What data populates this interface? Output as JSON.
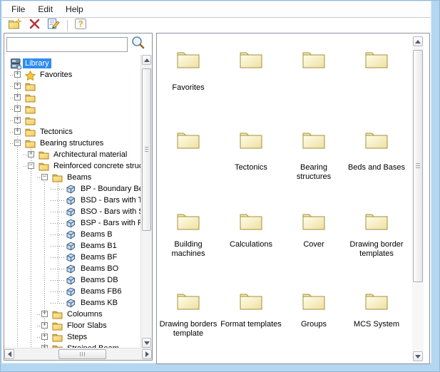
{
  "menu": {
    "items": [
      "File",
      "Edit",
      "Help"
    ]
  },
  "toolbar": {
    "buttons": [
      {
        "icon": "new-folder-icon"
      },
      {
        "icon": "delete-icon"
      },
      {
        "icon": "edit-icon"
      },
      {
        "icon": "help-icon"
      }
    ]
  },
  "search": {
    "value": "",
    "placeholder": "",
    "icon": "search-icon"
  },
  "colors": {
    "selection_blue": "#2e8def",
    "frame_blue": "#b5d6f0",
    "folder_yellow": "#f6e49c",
    "tree_folder_yellow": "#f9d978",
    "delete_red": "#b2353c"
  },
  "tree": {
    "rows": [
      {
        "level": 0,
        "icon": "library",
        "label": "Library",
        "expand": "",
        "selected": true
      },
      {
        "level": 1,
        "icon": "star",
        "label": "Favorites",
        "expand": "+"
      },
      {
        "level": 1,
        "icon": "folder",
        "label": "",
        "expand": "+"
      },
      {
        "level": 1,
        "icon": "folder",
        "label": "",
        "expand": "+"
      },
      {
        "level": 1,
        "icon": "folder",
        "label": "",
        "expand": "+"
      },
      {
        "level": 1,
        "icon": "folder",
        "label": "",
        "expand": "+"
      },
      {
        "level": 1,
        "icon": "folder",
        "label": "Tectonics",
        "expand": "+"
      },
      {
        "level": 1,
        "icon": "folder",
        "label": "Bearing structures",
        "expand": "-"
      },
      {
        "level": 2,
        "icon": "folder",
        "label": "Architectural material",
        "expand": "+"
      },
      {
        "level": 2,
        "icon": "folder",
        "label": "Reinforced concrete struct",
        "expand": "-"
      },
      {
        "level": 3,
        "icon": "folder",
        "label": "Beams",
        "expand": "-"
      },
      {
        "level": 4,
        "icon": "block",
        "label": "BP - Boundary Bea",
        "expand": ""
      },
      {
        "level": 4,
        "icon": "block",
        "label": "BSD - Bars with Tw",
        "expand": ""
      },
      {
        "level": 4,
        "icon": "block",
        "label": "BSO - Bars with Sl",
        "expand": ""
      },
      {
        "level": 4,
        "icon": "block",
        "label": "BSP - Bars with Pa",
        "expand": ""
      },
      {
        "level": 4,
        "icon": "block",
        "label": "Beams B",
        "expand": ""
      },
      {
        "level": 4,
        "icon": "block",
        "label": "Beams B1",
        "expand": ""
      },
      {
        "level": 4,
        "icon": "block",
        "label": "Beams BF",
        "expand": ""
      },
      {
        "level": 4,
        "icon": "block",
        "label": "Beams BO",
        "expand": ""
      },
      {
        "level": 4,
        "icon": "block",
        "label": "Beams DB",
        "expand": ""
      },
      {
        "level": 4,
        "icon": "block",
        "label": "Beams FB6",
        "expand": ""
      },
      {
        "level": 4,
        "icon": "block",
        "label": "Beams KB",
        "expand": ""
      },
      {
        "level": 3,
        "icon": "folder",
        "label": "Coloumns",
        "expand": "+"
      },
      {
        "level": 3,
        "icon": "folder",
        "label": "Floor Slabs",
        "expand": "+"
      },
      {
        "level": 3,
        "icon": "folder",
        "label": "Steps",
        "expand": "+"
      },
      {
        "level": 3,
        "icon": "folder",
        "label": "Strained Beam",
        "expand": "+"
      }
    ]
  },
  "grid": {
    "rows": [
      [
        "Favorites",
        "",
        "",
        ""
      ],
      [
        "",
        "Tectonics",
        "Bearing structures",
        "Beds and Bases"
      ],
      [
        "Building machines",
        "Calculations",
        "Cover",
        "Drawing border templates"
      ],
      [
        "Drawing borders template",
        "Format templates",
        "Groups",
        "MCS System"
      ]
    ]
  }
}
